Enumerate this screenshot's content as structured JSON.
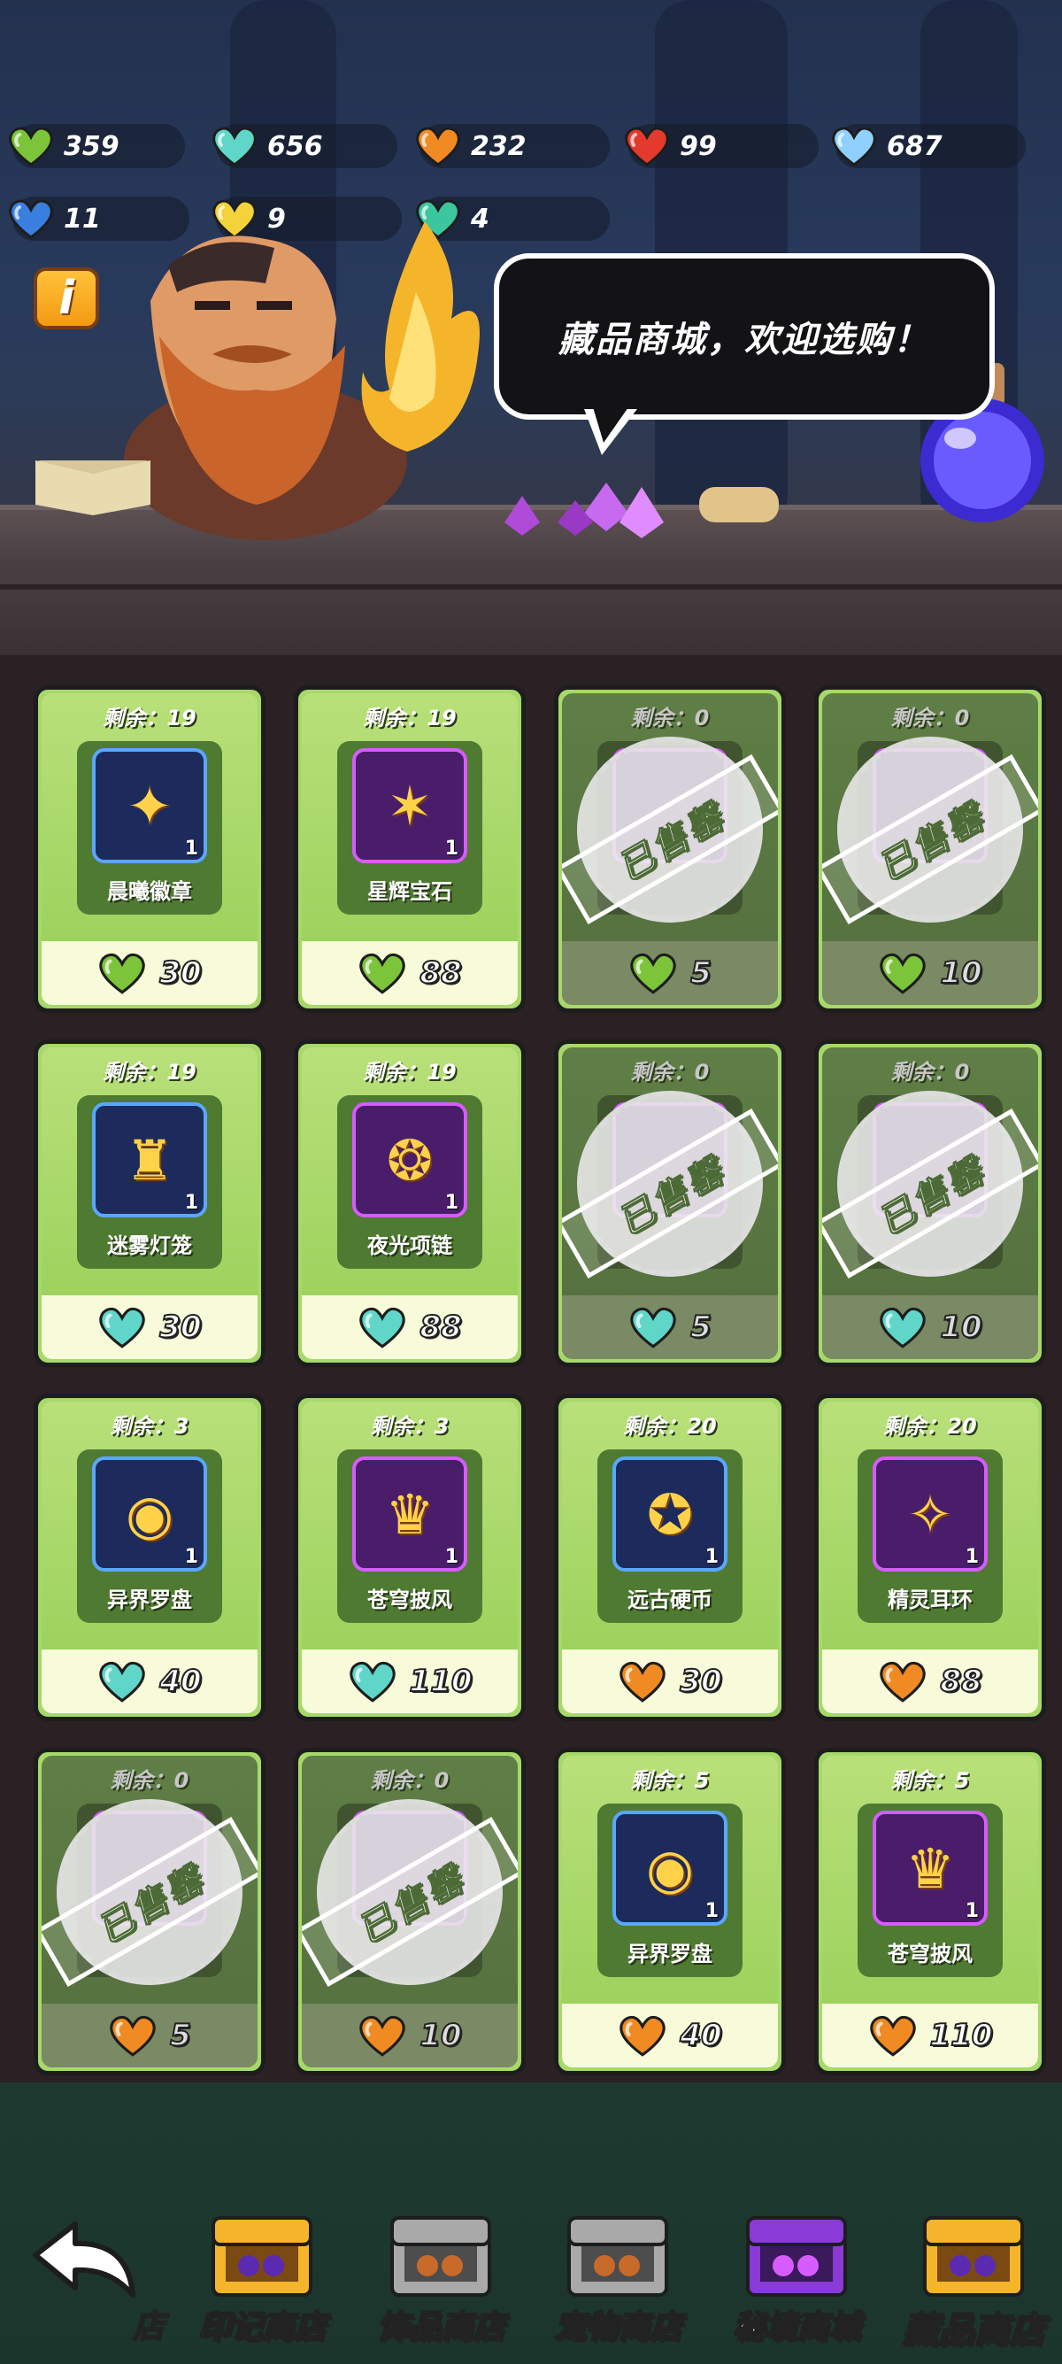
{
  "resources": [
    {
      "id": "green",
      "value": "359",
      "color": "#7cc43a"
    },
    {
      "id": "cyan",
      "value": "656",
      "color": "#5fd6c8"
    },
    {
      "id": "orange",
      "value": "232",
      "color": "#f08a22"
    },
    {
      "id": "red",
      "value": "99",
      "color": "#e23a2c"
    },
    {
      "id": "lightblue",
      "value": "687",
      "color": "#8fd0ff"
    },
    {
      "id": "blue",
      "value": "11",
      "color": "#3a7ee0"
    },
    {
      "id": "gold",
      "value": "9",
      "color": "#f3d23a"
    },
    {
      "id": "teal",
      "value": "4",
      "color": "#3cc6a0"
    }
  ],
  "info_label": "i",
  "bubble_text": "藏品商城，欢迎选购！",
  "remain_prefix": "剩余：",
  "sold_label": "已售罄",
  "items": [
    {
      "remain": "19",
      "name": "晨曦徽章",
      "qty": "1",
      "price": "30",
      "currency": "green",
      "sold": false,
      "frame": "blue",
      "icon": "✦"
    },
    {
      "remain": "19",
      "name": "星辉宝石",
      "qty": "1",
      "price": "88",
      "currency": "green",
      "sold": false,
      "frame": "purple",
      "icon": "✶"
    },
    {
      "remain": "0",
      "name": "",
      "qty": "",
      "price": "5",
      "currency": "green",
      "sold": true,
      "frame": "purple",
      "icon": ""
    },
    {
      "remain": "0",
      "name": "",
      "qty": "",
      "price": "10",
      "currency": "green",
      "sold": true,
      "frame": "purple",
      "icon": ""
    },
    {
      "remain": "19",
      "name": "迷雾灯笼",
      "qty": "1",
      "price": "30",
      "currency": "cyan",
      "sold": false,
      "frame": "blue",
      "icon": "♜"
    },
    {
      "remain": "19",
      "name": "夜光项链",
      "qty": "1",
      "price": "88",
      "currency": "cyan",
      "sold": false,
      "frame": "purple",
      "icon": "❂"
    },
    {
      "remain": "0",
      "name": "",
      "qty": "",
      "price": "5",
      "currency": "cyan",
      "sold": true,
      "frame": "purple",
      "icon": ""
    },
    {
      "remain": "0",
      "name": "",
      "qty": "",
      "price": "10",
      "currency": "cyan",
      "sold": true,
      "frame": "purple",
      "icon": ""
    },
    {
      "remain": "3",
      "name": "异界罗盘",
      "qty": "1",
      "price": "40",
      "currency": "cyan",
      "sold": false,
      "frame": "blue",
      "icon": "◉"
    },
    {
      "remain": "3",
      "name": "苍穹披风",
      "qty": "1",
      "price": "110",
      "currency": "cyan",
      "sold": false,
      "frame": "purple",
      "icon": "♛"
    },
    {
      "remain": "20",
      "name": "远古硬币",
      "qty": "1",
      "price": "30",
      "currency": "orange",
      "sold": false,
      "frame": "blue",
      "icon": "✪"
    },
    {
      "remain": "20",
      "name": "精灵耳环",
      "qty": "1",
      "price": "88",
      "currency": "orange",
      "sold": false,
      "frame": "purple",
      "icon": "✧"
    },
    {
      "remain": "0",
      "name": "",
      "qty": "",
      "price": "5",
      "currency": "orange",
      "sold": true,
      "frame": "purple",
      "icon": ""
    },
    {
      "remain": "0",
      "name": "",
      "qty": "",
      "price": "10",
      "currency": "orange",
      "sold": true,
      "frame": "purple",
      "icon": ""
    },
    {
      "remain": "5",
      "name": "异界罗盘",
      "qty": "1",
      "price": "40",
      "currency": "orange",
      "sold": false,
      "frame": "blue",
      "icon": "◉"
    },
    {
      "remain": "5",
      "name": "苍穹披风",
      "qty": "1",
      "price": "110",
      "currency": "orange",
      "sold": false,
      "frame": "purple",
      "icon": "♛"
    }
  ],
  "nav": {
    "edge_label": "店",
    "tabs": [
      {
        "label": "印记商店",
        "chest": "gold"
      },
      {
        "label": "饰品商店",
        "chest": "silver"
      },
      {
        "label": "宠物商店",
        "chest": "silver"
      },
      {
        "label": "秘境商城",
        "chest": "purple"
      },
      {
        "label": "藏品商店",
        "chest": "gold",
        "active": true
      }
    ]
  }
}
